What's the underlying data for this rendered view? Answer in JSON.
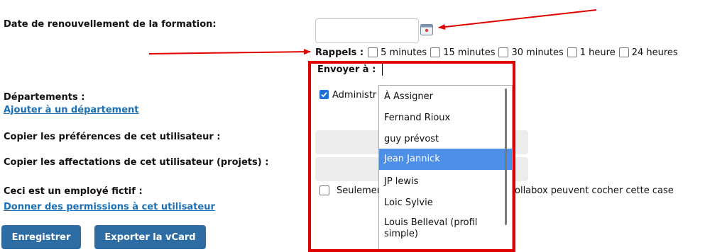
{
  "labels": {
    "renewal_date": "Date de renouvellement de la formation:",
    "departments": "Départements :",
    "copy_prefs": "Copier les préférences de cet utilisateur :",
    "copy_assign": "Copier les affectations de cet utilisateur (projets) :",
    "fictive": "Ceci est un employé fictif :"
  },
  "links": {
    "add_department": "Ajouter à un département",
    "give_permissions": "Donner des permissions à cet utilisateur"
  },
  "date_input": {
    "value": ""
  },
  "reminders": {
    "label": "Rappels :",
    "options": [
      "5 minutes",
      "15 minutes",
      "30 minutes",
      "1 heure",
      "24 heures"
    ]
  },
  "send_to": {
    "label": "Envoyer à :",
    "value": ""
  },
  "admin_checkbox": {
    "label": "Administr",
    "checked": true
  },
  "only_checkbox": {
    "label_start": "Seulemen",
    "label_end": "ollabox peuvent cocher cette case",
    "checked": false
  },
  "dropdown": {
    "items": [
      "À Assigner",
      "Fernand Rioux",
      "guy prévost",
      "Jean Jannick",
      "JP lewis",
      "Loic Sylvie",
      "Louis Belleval (profil simple)"
    ],
    "selected": "Jean Jannick"
  },
  "buttons": {
    "save": "Enregistrer",
    "export_vcard": "Exporter la vCard"
  },
  "colors": {
    "annotation_red": "#e10000",
    "selected_blue": "#4d8fe6",
    "button_blue": "#2e6da4",
    "link_blue": "#1a6fb5"
  }
}
